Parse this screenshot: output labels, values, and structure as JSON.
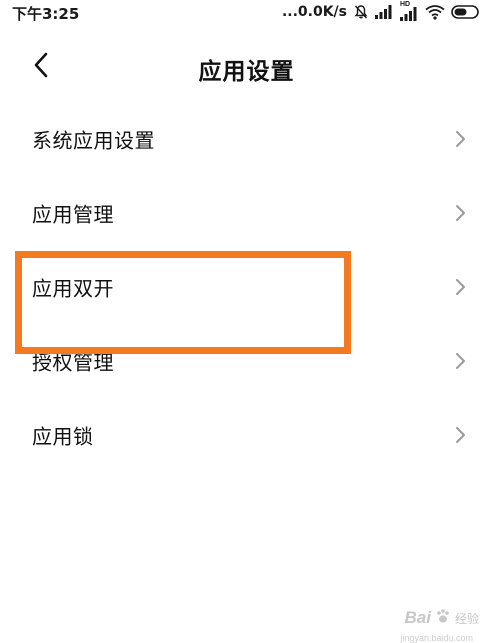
{
  "status_bar": {
    "time": "下午3:25",
    "net_speed": "...0.0K/s",
    "network_label": "HD",
    "icons": [
      "mute-bell-icon",
      "signal-icon",
      "hd-signal-icon",
      "wifi-icon",
      "battery-icon"
    ]
  },
  "header": {
    "back_icon": "chevron-left-icon",
    "title": "应用设置"
  },
  "settings": {
    "items": [
      {
        "label": "系统应用设置",
        "icon": "chevron-right-icon"
      },
      {
        "label": "应用管理",
        "icon": "chevron-right-icon"
      },
      {
        "label": "应用双开",
        "icon": "chevron-right-icon"
      },
      {
        "label": "授权管理",
        "icon": "chevron-right-icon"
      },
      {
        "label": "应用锁",
        "icon": "chevron-right-icon"
      }
    ]
  },
  "annotation": {
    "highlight_color": "#f47920"
  },
  "watermark": {
    "brand": "Bai",
    "sub": "经验",
    "url": "jingyan.baidu.com"
  },
  "colors": {
    "text": "#111111",
    "chevron": "#9a9a9a",
    "background": "#ffffff"
  }
}
